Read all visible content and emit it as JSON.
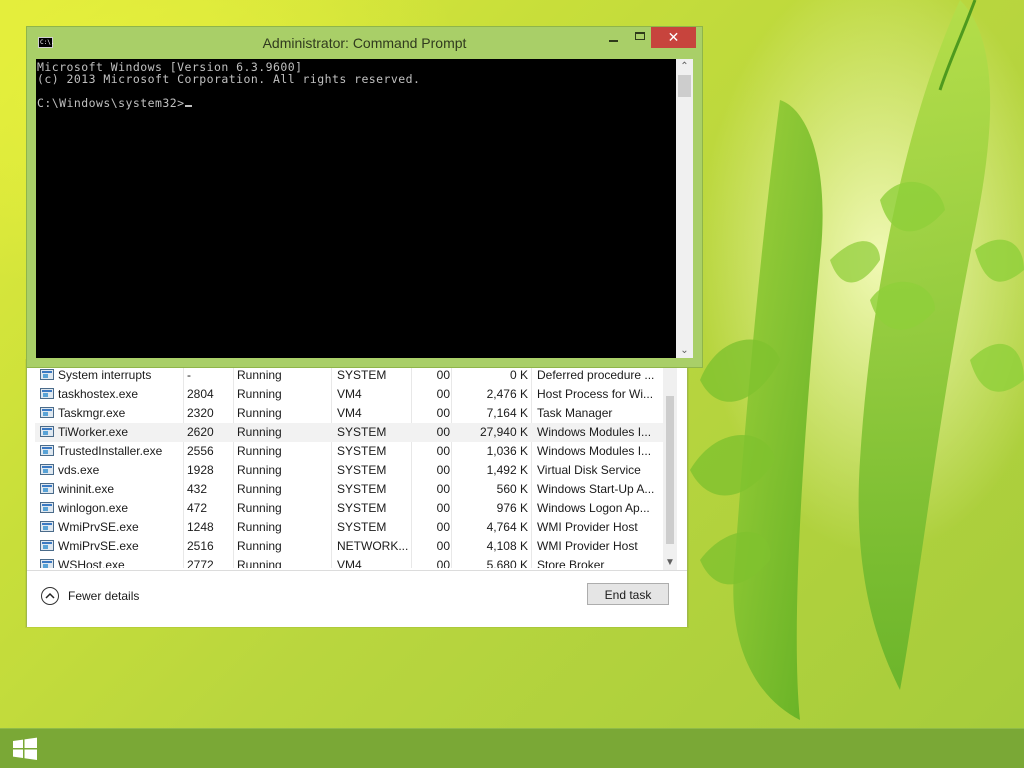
{
  "cmd": {
    "title": "Administrator:  Command Prompt",
    "icon_text": "C:\\.",
    "close_label": "✕",
    "lines": [
      "Microsoft Windows [Version 6.3.9600]",
      "(c) 2013 Microsoft Corporation. All rights reserved.",
      "",
      "C:\\Windows\\system32>"
    ]
  },
  "task_manager": {
    "rows": [
      {
        "name": "System interrupts",
        "pid": "-",
        "status": "Running",
        "user": "SYSTEM",
        "cpu": "00",
        "memory": "0 K",
        "description": "Deferred procedure ..."
      },
      {
        "name": "taskhostex.exe",
        "pid": "2804",
        "status": "Running",
        "user": "VM4",
        "cpu": "00",
        "memory": "2,476 K",
        "description": "Host Process for Wi..."
      },
      {
        "name": "Taskmgr.exe",
        "pid": "2320",
        "status": "Running",
        "user": "VM4",
        "cpu": "00",
        "memory": "7,164 K",
        "description": "Task Manager"
      },
      {
        "name": "TiWorker.exe",
        "pid": "2620",
        "status": "Running",
        "user": "SYSTEM",
        "cpu": "00",
        "memory": "27,940 K",
        "description": "Windows Modules I..."
      },
      {
        "name": "TrustedInstaller.exe",
        "pid": "2556",
        "status": "Running",
        "user": "SYSTEM",
        "cpu": "00",
        "memory": "1,036 K",
        "description": "Windows Modules I..."
      },
      {
        "name": "vds.exe",
        "pid": "1928",
        "status": "Running",
        "user": "SYSTEM",
        "cpu": "00",
        "memory": "1,492 K",
        "description": "Virtual Disk Service"
      },
      {
        "name": "wininit.exe",
        "pid": "432",
        "status": "Running",
        "user": "SYSTEM",
        "cpu": "00",
        "memory": "560 K",
        "description": "Windows Start-Up A..."
      },
      {
        "name": "winlogon.exe",
        "pid": "472",
        "status": "Running",
        "user": "SYSTEM",
        "cpu": "00",
        "memory": "976 K",
        "description": "Windows Logon Ap..."
      },
      {
        "name": "WmiPrvSE.exe",
        "pid": "1248",
        "status": "Running",
        "user": "SYSTEM",
        "cpu": "00",
        "memory": "4,764 K",
        "description": "WMI Provider Host"
      },
      {
        "name": "WmiPrvSE.exe",
        "pid": "2516",
        "status": "Running",
        "user": "NETWORK...",
        "cpu": "00",
        "memory": "4,108 K",
        "description": "WMI Provider Host"
      },
      {
        "name": "WSHost.exe",
        "pid": "2772",
        "status": "Running",
        "user": "VM4",
        "cpu": "00",
        "memory": "5,680 K",
        "description": "Store Broker"
      }
    ],
    "selected_row": 3,
    "fewer_details_label": "Fewer details",
    "end_task_label": "End task"
  },
  "colors": {
    "cmd_frame": "#a9cf68",
    "close_button": "#c7443d",
    "console_bg": "#000000",
    "console_text": "#c0c0c0",
    "taskbar": "#7aa836"
  }
}
